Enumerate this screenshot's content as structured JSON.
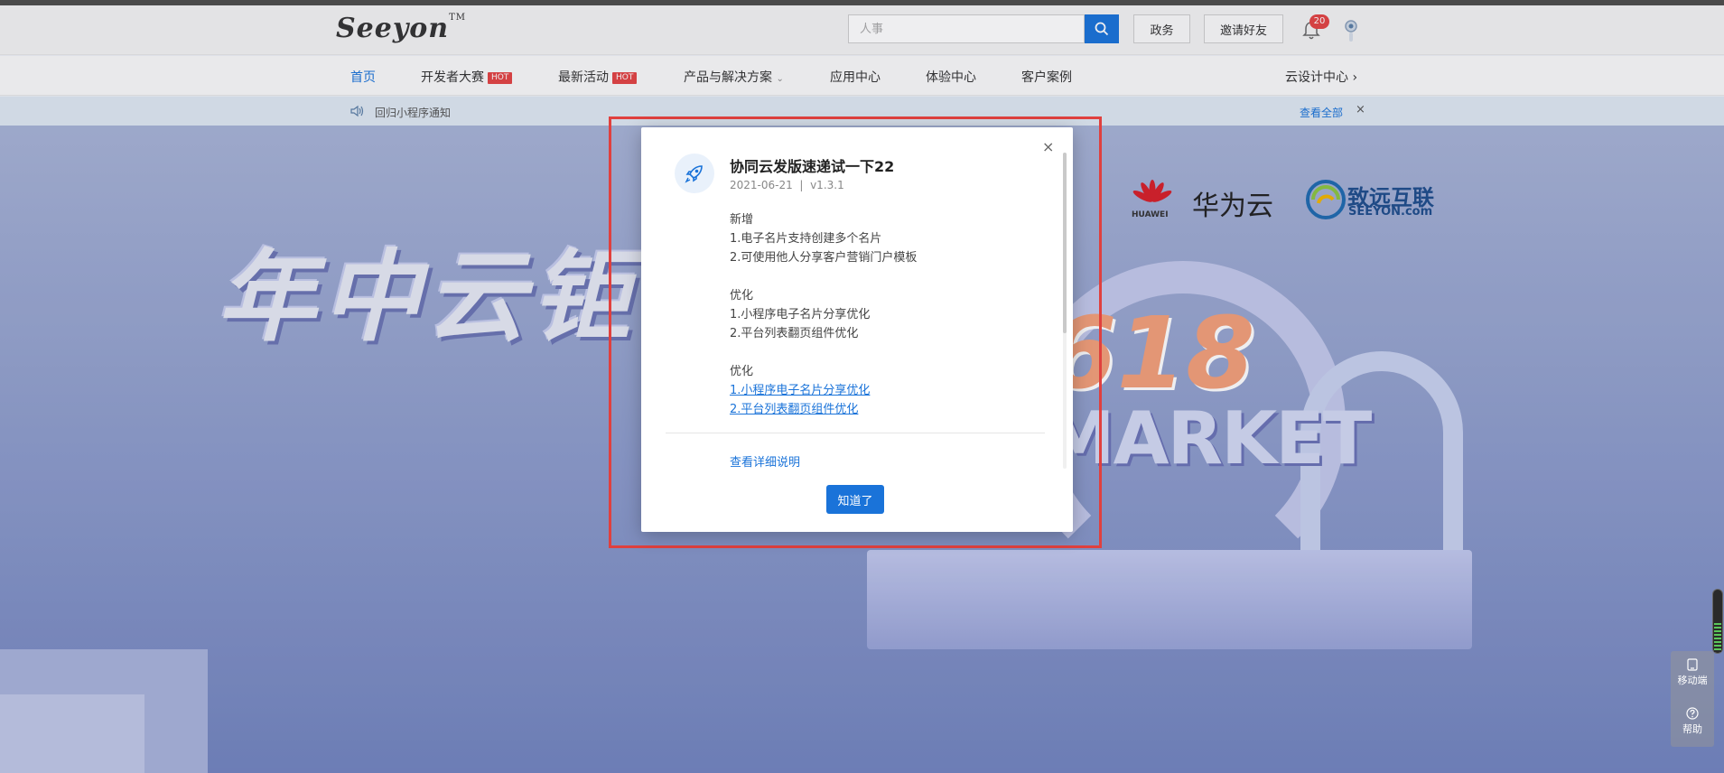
{
  "header": {
    "logo": "Seeyon",
    "logo_tm": "TM",
    "search_placeholder": "人事",
    "btn_gov": "政务",
    "btn_invite": "邀请好友",
    "notification_count": "20"
  },
  "nav": {
    "items": [
      {
        "label": "首页",
        "active": true
      },
      {
        "label": "开发者大赛",
        "hot": "HOT"
      },
      {
        "label": "最新活动",
        "hot": "HOT"
      },
      {
        "label": "产品与解决方案",
        "caret": "⌄"
      },
      {
        "label": "应用中心"
      },
      {
        "label": "体验中心"
      },
      {
        "label": "客户案例"
      }
    ],
    "right": "云设计中心",
    "right_arrow": "›"
  },
  "notice": {
    "text": "回归小程序通知",
    "view_all": "查看全部",
    "close": "×"
  },
  "banner": {
    "title": "年中云钜",
    "huawei_label": "HUAWEI",
    "huawei_cloud": "华为云",
    "seeyon_cn": "致远互联",
    "seeyon_en": "SEEYON.com",
    "big_number": "618",
    "market": "MARKET"
  },
  "modal": {
    "title": "协同云发版速递试一下22",
    "date": "2021-06-21",
    "separator": "|",
    "version": "v1.3.1",
    "sections": [
      {
        "heading": "新增",
        "lines": [
          "1.电子名片支持创建多个名片",
          "2.可使用他人分享客户营销门户模板"
        ]
      },
      {
        "heading": "优化",
        "lines": [
          "1.小程序电子名片分享优化",
          "2.平台列表翻页组件优化"
        ]
      },
      {
        "heading": "优化",
        "links": [
          "1.小程序电子名片分享优化",
          "2.平台列表翻页组件优化"
        ]
      }
    ],
    "detail_link": "查看详细说明",
    "ok_button": "知道了",
    "close": "×"
  },
  "side": {
    "mobile": "移动端",
    "help": "帮助"
  },
  "colors": {
    "primary": "#1a73d9",
    "hot": "#e34444",
    "highlight": "#e0403e"
  }
}
